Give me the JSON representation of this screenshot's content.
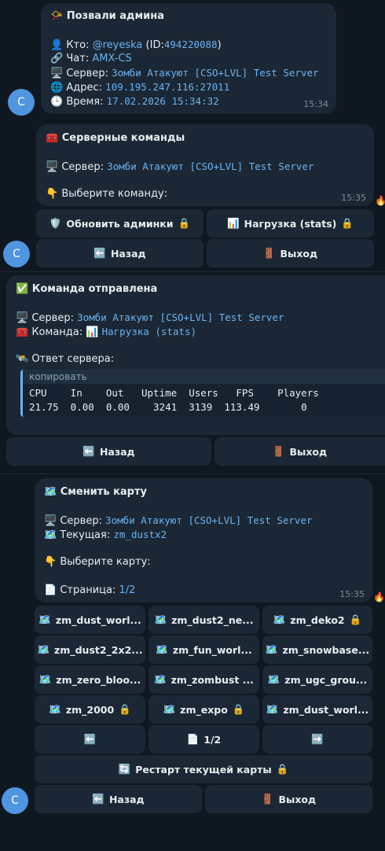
{
  "msg1": {
    "title": "Позвали админа",
    "who_label": "Кто:",
    "who_user": "@reyeska",
    "who_id_open": "(ID:",
    "who_id": "494220088",
    "who_id_close": ")",
    "chat_label": "Чат:",
    "chat_value": "AMX-CS",
    "server_label": "Сервер:",
    "server_value": "Зомби Атакуют [CSO+LVL] Test Server",
    "address_label": "Адрес:",
    "address_value": "109.195.247.116:27011",
    "time_label": "Время:",
    "time_value": "17.02.2026 15:34:32",
    "timestamp": "15:34"
  },
  "msg2": {
    "title": "Серверные команды",
    "server_label": "Сервер:",
    "server_value": "Зомби Атакуют [CSO+LVL] Test Server",
    "prompt": "Выберите команду:",
    "timestamp": "15:35",
    "buttons": {
      "refresh_admins": "Обновить админки",
      "stats": "Нагрузка (stats)",
      "back": "Назад",
      "exit": "Выход"
    }
  },
  "msg3": {
    "title": "Команда отправлена",
    "server_label": "Сервер:",
    "server_value": "Зомби Атакуют [CSO+LVL] Test Server",
    "command_label": "Команда:",
    "command_value": "Нагрузка (stats)",
    "reply_label": "Ответ сервера:",
    "copy_label": "копировать",
    "stats_header": "CPU    In    Out   Uptime  Users   FPS    Players",
    "stats_row": "21.75  0.00  0.00    3241  3139  113.49       0",
    "buttons": {
      "back": "Назад",
      "exit": "Выход"
    }
  },
  "msg4": {
    "title": "Сменить карту",
    "server_label": "Сервер:",
    "server_value": "Зомби Атакуют [CSO+LVL] Test Server",
    "current_label": "Текущая:",
    "current_value": "zm_dustx2",
    "prompt": "Выберите карту:",
    "page_label": "Страница:",
    "page_value": "1/2",
    "timestamp": "15:35",
    "maps": [
      "zm_dust_worl...",
      "zm_dust2_ne...",
      "zm_deko2",
      "zm_dust2_2x2...",
      "zm_fun_worl...",
      "zm_snowbase...",
      "zm_zero_bloo...",
      "zm_zombust ...",
      "zm_ugc_grou...",
      "zm_2000",
      "zm_expo",
      "zm_dust_worl..."
    ],
    "nav_page": "1/2",
    "restart": "Рестарт текущей карты",
    "back": "Назад",
    "exit": "Выход"
  },
  "avatar_letter": "C",
  "icons": {
    "megaphone": "📯",
    "user": "👤",
    "chain": "🔗",
    "computer": "🖥️",
    "globe": "🌐",
    "clock": "🕒",
    "toolbox": "🧰",
    "point-down": "👇",
    "shield": "🛡️",
    "chart": "📊",
    "lock": "🔒",
    "back-arrow": "⬅️",
    "door": "🚪",
    "check": "✅",
    "satellite": "🛰️",
    "map": "🗺️",
    "page": "📄",
    "refresh": "🔄",
    "next-arrow": "➡️",
    "fire": "🔥"
  }
}
